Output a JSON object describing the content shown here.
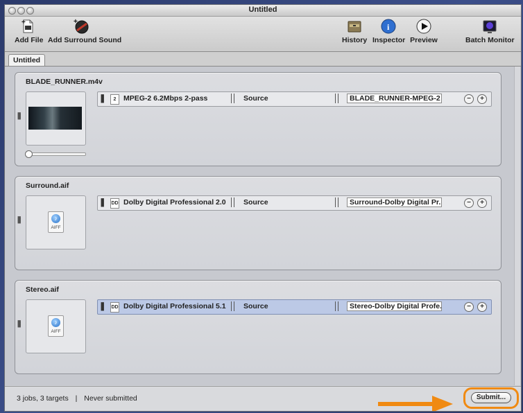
{
  "window": {
    "title": "Untitled"
  },
  "toolbar": {
    "add_file": "Add File",
    "add_surround": "Add Surround Sound",
    "history": "History",
    "inspector": "Inspector",
    "preview": "Preview",
    "batch_monitor": "Batch Monitor"
  },
  "tabs": [
    {
      "label": "Untitled"
    }
  ],
  "jobs": [
    {
      "name": "BLADE_RUNNER.m4v",
      "target": {
        "setting": "MPEG-2 6.2Mbps 2-pass",
        "destination": "Source",
        "output": "BLADE_RUNNER-MPEG-2 ..."
      }
    },
    {
      "name": "Surround.aif",
      "target": {
        "setting": "Dolby Digital Professional 2.0",
        "destination": "Source",
        "output": "Surround-Dolby Digital Pr..."
      }
    },
    {
      "name": "Stereo.aif",
      "target": {
        "setting": "Dolby Digital Professional 5.1",
        "destination": "Source",
        "output": "Stereo-Dolby Digital Profe..."
      }
    }
  ],
  "status": {
    "summary": "3 jobs, 3 targets",
    "separator": "|",
    "state": "Never submitted"
  },
  "submit_label": "Submit...",
  "aiff_label": "AIFF",
  "colors": {
    "highlight": "#f08a12",
    "selected_row": "#bcc9e6"
  }
}
